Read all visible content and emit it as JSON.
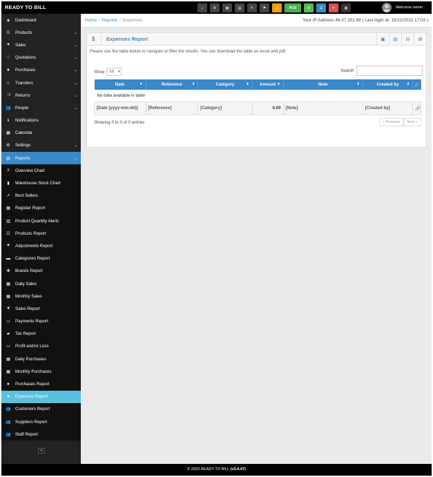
{
  "app": {
    "brand": "READY TO BILL",
    "welcome": "Welcome owner"
  },
  "topbar": {
    "buttons": [
      {
        "name": "home-icon",
        "glyph": "⌂"
      },
      {
        "name": "gear-icon",
        "glyph": "⚙"
      },
      {
        "name": "calculator-icon",
        "glyph": "▦"
      },
      {
        "name": "calendar-icon",
        "glyph": "▤"
      },
      {
        "name": "edit-icon",
        "glyph": "✎"
      },
      {
        "name": "flag-icon",
        "glyph": "⚑"
      },
      {
        "name": "alert-icon",
        "glyph": "⚠"
      },
      {
        "name": "pos-button",
        "glyph": "POS"
      },
      {
        "name": "hourglass-icon",
        "glyph": "⧗"
      },
      {
        "name": "list-icon",
        "glyph": "☰"
      },
      {
        "name": "tools-icon",
        "glyph": "✂"
      },
      {
        "name": "grid-icon",
        "glyph": "▦"
      }
    ]
  },
  "sidebar": {
    "items": [
      {
        "label": "Dashboard",
        "icon": "◈",
        "chev": ""
      },
      {
        "label": "Products",
        "icon": "☷",
        "chev": "⌄"
      },
      {
        "label": "Sales",
        "icon": "♥",
        "chev": "⌄"
      },
      {
        "label": "Quotations",
        "icon": "♡",
        "chev": "⌄"
      },
      {
        "label": "Purchases",
        "icon": "★",
        "chev": "⌄"
      },
      {
        "label": "Transfers",
        "icon": "☆",
        "chev": "⌄"
      },
      {
        "label": "Returns",
        "icon": "⤨",
        "chev": "⌄"
      },
      {
        "label": "People",
        "icon": "👥",
        "chev": "⌄"
      },
      {
        "label": "Notifications",
        "icon": "ℹ",
        "chev": ""
      },
      {
        "label": "Calendar",
        "icon": "▦",
        "chev": ""
      },
      {
        "label": "Settings",
        "icon": "⚙",
        "chev": "⌄"
      },
      {
        "label": "Reports",
        "icon": "▥",
        "chev": "⌄"
      }
    ],
    "reports_sub": [
      {
        "label": "Overview Chart",
        "icon": "≡"
      },
      {
        "label": "Warehouse Stock Chart",
        "icon": "▮"
      },
      {
        "label": "Best Sellers",
        "icon": "↗"
      },
      {
        "label": "Register Report",
        "icon": "▦"
      },
      {
        "label": "Product Quantity Alerts",
        "icon": "▥"
      },
      {
        "label": "Products Report",
        "icon": "☷"
      },
      {
        "label": "Adjustments Report",
        "icon": "▼"
      },
      {
        "label": "Categories Report",
        "icon": "▬"
      },
      {
        "label": "Brands Report",
        "icon": "✤"
      },
      {
        "label": "Daily Sales",
        "icon": "▦"
      },
      {
        "label": "Monthly Sales",
        "icon": "▦"
      },
      {
        "label": "Sales Report",
        "icon": "♥"
      },
      {
        "label": "Payments Report",
        "icon": "▭"
      },
      {
        "label": "Tax Report",
        "icon": "▰"
      },
      {
        "label": "Profit and/or Loss",
        "icon": "▭"
      },
      {
        "label": "Daily Purchases",
        "icon": "▦"
      },
      {
        "label": "Monthly Purchases",
        "icon": "▦"
      },
      {
        "label": "Purchases Report",
        "icon": "★"
      },
      {
        "label": "Expenses Report",
        "icon": "★"
      },
      {
        "label": "Customers Report",
        "icon": "👥"
      },
      {
        "label": "Suppliers Report",
        "icon": "👥"
      },
      {
        "label": "Staff Report",
        "icon": "👥"
      }
    ],
    "current_item": "Expenses Report",
    "collapse_glyph": "«"
  },
  "breadcrumb": {
    "home": "Home",
    "reports": "Reports",
    "current": "Expenses"
  },
  "ipinfo": "Your IP Address 49.37.201.89 ( Last login at: 15/12/2022 17:03 )",
  "box": {
    "icon": "$",
    "title": "Expenses Report",
    "tools": [
      "▣",
      "▤",
      "⊟",
      "⊠"
    ],
    "intro": "Please use the table below to navigate or filter the results. You can download the table as excel and pdf."
  },
  "table_controls": {
    "show_label": "Show",
    "page_size": "10",
    "search_label": "Search",
    "search_value": ""
  },
  "table": {
    "columns": [
      "Date",
      "Reference",
      "Category",
      "Amount",
      "Note",
      "Created by",
      ""
    ],
    "empty_message": "No data available in table",
    "footer": [
      "[Date (yyyy-mm-dd)]",
      "[Reference]",
      "[Category]",
      "0.00",
      "[Note]",
      "[Created by]",
      "🔗"
    ]
  },
  "showing": "Showing 0 to 0 of 0 entries",
  "pager": {
    "prev": "« Previous",
    "next": "Next »"
  },
  "footer": {
    "text": "© 2022 READY TO BILL ",
    "version": "(v3.4.47)"
  }
}
